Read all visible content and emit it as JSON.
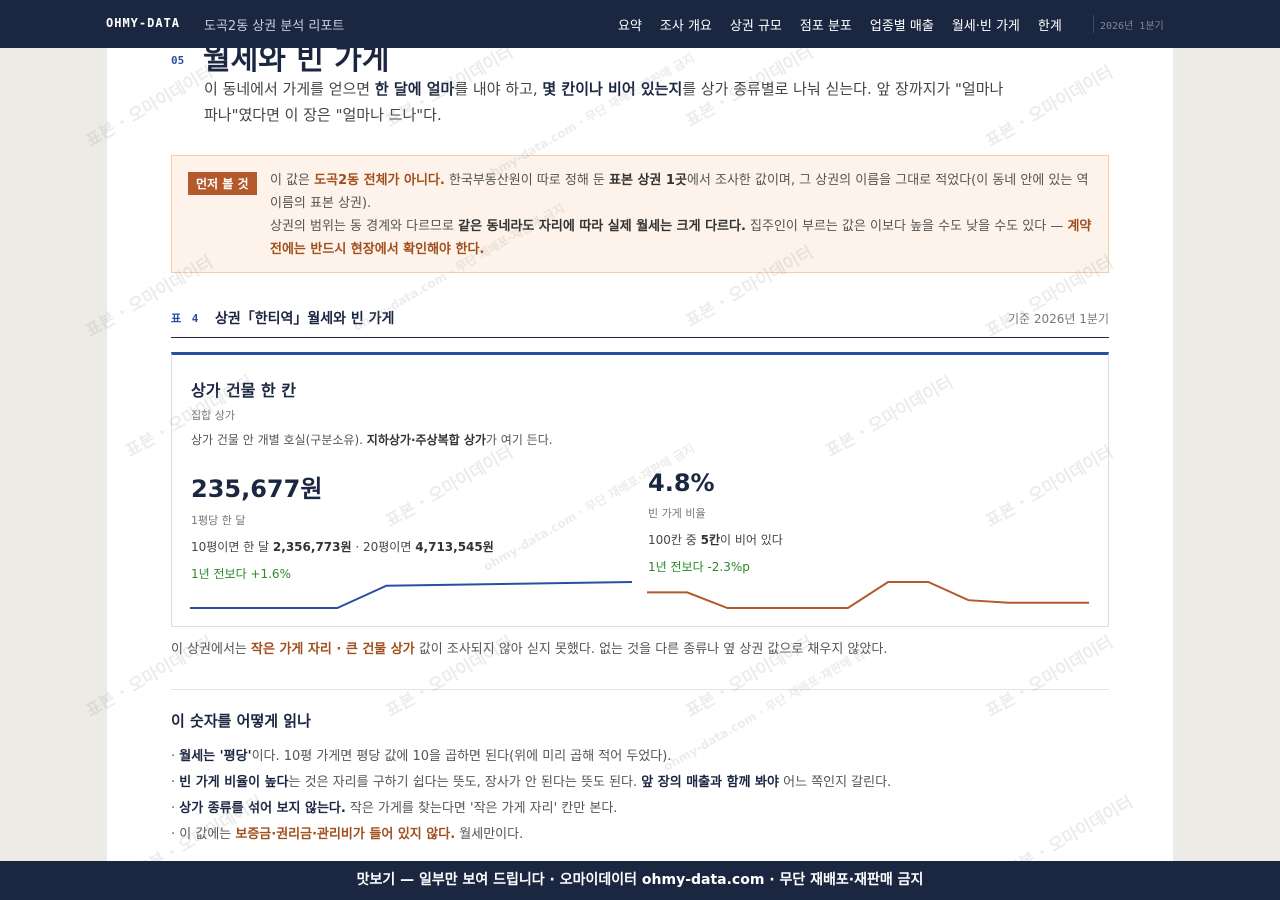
{
  "nav": {
    "brand": "OHMY-DATA",
    "report_title": "도곡2동 상권 분석 리포트",
    "items": [
      "요약",
      "조사 개요",
      "상권 규모",
      "점포 분포",
      "업종별 매출",
      "월세·빈 가게",
      "한계"
    ],
    "period": "2026년 1분기"
  },
  "section": {
    "number": "05",
    "title": "월세와 빈 가게",
    "intro": {
      "p1": "이 동네에서 가게를 얻으면 ",
      "b1": "한 달에 얼마",
      "p2": "를 내야 하고, ",
      "b2": "몇 칸이나 비어 있는지",
      "p3": "를 상가 종류별로 나눠 싣는다. 앞 장까지가 \"얼마나 파나\"였다면 이 장은 \"얼마나 드나\"다."
    }
  },
  "notice": {
    "badge": "먼저 볼 것",
    "l1a": "이 값은 ",
    "l1hl": "도곡2동 전체가 아니다.",
    "l1b": " 한국부동산원이 따로 정해 둔 ",
    "l1bold": "표본 상권 1곳",
    "l1c": "에서 조사한 값이며, 그 상권의 이름을 그대로 적었다(이 동네 안에 있는 역 이름의 표본 상권).",
    "l2a": "상권의 범위는 동 경계와 다르므로 ",
    "l2bold": "같은 동네라도 자리에 따라 실제 월세는 크게 다르다.",
    "l2b": " 집주인이 부르는 값은 이보다 높을 수도 낮을 수도 있다 — ",
    "l2hl": "계약 전에는 반드시 현장에서 확인해야 한다."
  },
  "table": {
    "label": "표 4",
    "title": "상권「한티역」월세와 빈 가게",
    "date": "기준 2026년 1분기"
  },
  "card": {
    "title": "상가 건물 한 칸",
    "subtitle": "집합 상가",
    "desc_a": "상가 건물 안 개별 호실(구분소유). ",
    "desc_b": "지하상가·주상복합 상가",
    "desc_c": "가 여기 든다.",
    "rent": {
      "value": "235,677원",
      "label": "1평당 한 달",
      "d1": "10평이면 한 달 ",
      "d1b": "2,356,773원",
      "d2": " · 20평이면 ",
      "d2b": "4,713,545원",
      "delta": "1년 전보다 +1.6%"
    },
    "vacancy": {
      "value": "4.8%",
      "label": "빈 가게 비율",
      "d1": "100칸 중 ",
      "d1b": "5칸",
      "d2": "이 비어 있다",
      "delta": "1년 전보다 -2.3%p"
    }
  },
  "chart_data": [
    {
      "type": "line",
      "series": [
        {
          "values": [
            0.2,
            0.2,
            0.2,
            0.2,
            1.7,
            1.75,
            1.8,
            1.85,
            1.9,
            1.95
          ]
        }
      ],
      "color": "#2a4ea2"
    },
    {
      "type": "line",
      "series": [
        {
          "values": [
            7.1,
            7.1,
            6.5,
            6.5,
            6.5,
            6.5,
            7.5,
            7.5,
            6.8,
            6.7,
            6.7,
            6.7
          ]
        }
      ],
      "color": "#b4592b"
    }
  ],
  "footnote": {
    "a": "이 상권에서는 ",
    "hl": "작은 가게 자리 · 큰 건물 상가",
    "b": " 값이 조사되지 않아 싣지 못했다. 없는 것을 다른 종류나 옆 상권 값으로 채우지 않았다."
  },
  "how": {
    "title": "이 숫자를 어떻게 읽나",
    "i1a": "· ",
    "i1b": "월세는 '평당'",
    "i1c": "이다. 10평 가게면 평당 값에 10을 곱하면 된다(위에 미리 곱해 적어 두었다).",
    "i2a": "· ",
    "i2b": "빈 가게 비율이 높다",
    "i2c": "는 것은 자리를 구하기 쉽다는 뜻도, 장사가 안 된다는 뜻도 된다. ",
    "i2d": "앞 장의 매출과 함께 봐야",
    "i2e": " 어느 쪽인지 갈린다.",
    "i3a": "· ",
    "i3b": "상가 종류를 섞어 보지 않는다.",
    "i3c": " 작은 가게를 찾는다면 '작은 가게 자리' 칸만 본다.",
    "i4a": "· 이 값에는 ",
    "i4b": "보증금·권리금·관리비가 들어 있지 않다.",
    "i4c": " 월세만이다."
  },
  "watermark": {
    "text": "표본 · 오마이데이터",
    "sub": "ohmy-data.com · 무단 재배포·재판매 금지"
  },
  "bottom": {
    "text": "맛보기 — 일부만 보여 드립니다 · 오마이데이터 ohmy-data.com · 무단 재배포·재판매 금지"
  }
}
